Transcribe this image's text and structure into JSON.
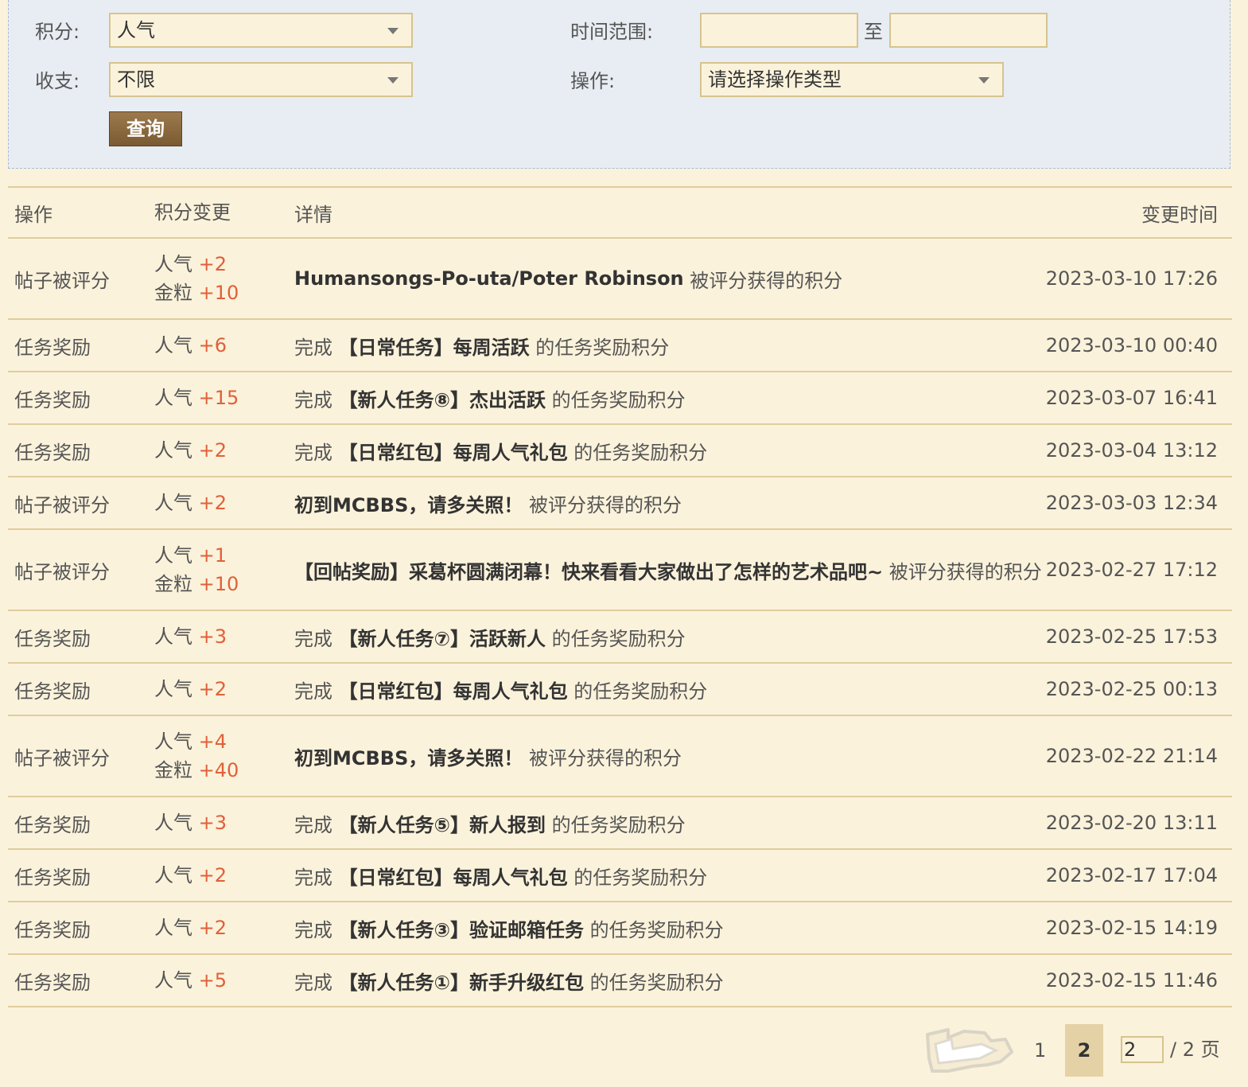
{
  "filter": {
    "score_label": "积分:",
    "score_value": "人气",
    "flow_label": "收支:",
    "flow_value": "不限",
    "time_label": "时间范围:",
    "time_from": "",
    "time_sep": "至",
    "time_to": "",
    "op_label": "操作:",
    "op_value": "请选择操作类型",
    "query_label": "查询"
  },
  "table": {
    "headers": {
      "op": "操作",
      "change": "积分变更",
      "detail": "详情",
      "time": "变更时间"
    },
    "rows": [
      {
        "op": "帖子被评分",
        "changes": [
          {
            "k": "人气",
            "v": "+2"
          },
          {
            "k": "金粒",
            "v": "+10"
          }
        ],
        "prefix": "",
        "bold": "Humansongs-Po-uta/Poter Robinson",
        "suffix": " 被评分获得的积分",
        "time": "2023-03-10 17:26"
      },
      {
        "op": "任务奖励",
        "changes": [
          {
            "k": "人气",
            "v": "+6"
          }
        ],
        "prefix": "完成 ",
        "bold": "【日常任务】每周活跃",
        "suffix": " 的任务奖励积分",
        "time": "2023-03-10 00:40"
      },
      {
        "op": "任务奖励",
        "changes": [
          {
            "k": "人气",
            "v": "+15"
          }
        ],
        "prefix": "完成 ",
        "bold": "【新人任务⑧】杰出活跃",
        "suffix": " 的任务奖励积分",
        "time": "2023-03-07 16:41"
      },
      {
        "op": "任务奖励",
        "changes": [
          {
            "k": "人气",
            "v": "+2"
          }
        ],
        "prefix": "完成 ",
        "bold": "【日常红包】每周人气礼包",
        "suffix": " 的任务奖励积分",
        "time": "2023-03-04 13:12"
      },
      {
        "op": "帖子被评分",
        "changes": [
          {
            "k": "人气",
            "v": "+2"
          }
        ],
        "prefix": "",
        "bold": "初到MCBBS，请多关照！",
        "suffix": " 被评分获得的积分",
        "time": "2023-03-03 12:34"
      },
      {
        "op": "帖子被评分",
        "changes": [
          {
            "k": "人气",
            "v": "+1"
          },
          {
            "k": "金粒",
            "v": "+10"
          }
        ],
        "prefix": "",
        "bold": "【回帖奖励】采葛杯圆满闭幕！快来看看大家做出了怎样的艺术品吧~",
        "suffix": " 被评分获得的积分",
        "time": "2023-02-27 17:12"
      },
      {
        "op": "任务奖励",
        "changes": [
          {
            "k": "人气",
            "v": "+3"
          }
        ],
        "prefix": "完成 ",
        "bold": "【新人任务⑦】活跃新人",
        "suffix": " 的任务奖励积分",
        "time": "2023-02-25 17:53"
      },
      {
        "op": "任务奖励",
        "changes": [
          {
            "k": "人气",
            "v": "+2"
          }
        ],
        "prefix": "完成 ",
        "bold": "【日常红包】每周人气礼包",
        "suffix": " 的任务奖励积分",
        "time": "2023-02-25 00:13"
      },
      {
        "op": "帖子被评分",
        "changes": [
          {
            "k": "人气",
            "v": "+4"
          },
          {
            "k": "金粒",
            "v": "+40"
          }
        ],
        "prefix": "",
        "bold": "初到MCBBS，请多关照！",
        "suffix": " 被评分获得的积分",
        "time": "2023-02-22 21:14"
      },
      {
        "op": "任务奖励",
        "changes": [
          {
            "k": "人气",
            "v": "+3"
          }
        ],
        "prefix": "完成 ",
        "bold": "【新人任务⑤】新人报到",
        "suffix": " 的任务奖励积分",
        "time": "2023-02-20 13:11"
      },
      {
        "op": "任务奖励",
        "changes": [
          {
            "k": "人气",
            "v": "+2"
          }
        ],
        "prefix": "完成 ",
        "bold": "【日常红包】每周人气礼包",
        "suffix": " 的任务奖励积分",
        "time": "2023-02-17 17:04"
      },
      {
        "op": "任务奖励",
        "changes": [
          {
            "k": "人气",
            "v": "+2"
          }
        ],
        "prefix": "完成 ",
        "bold": "【新人任务③】验证邮箱任务",
        "suffix": " 的任务奖励积分",
        "time": "2023-02-15 14:19"
      },
      {
        "op": "任务奖励",
        "changes": [
          {
            "k": "人气",
            "v": "+5"
          }
        ],
        "prefix": "完成 ",
        "bold": "【新人任务①】新手升级红包",
        "suffix": " 的任务奖励积分",
        "time": "2023-02-15 11:46"
      }
    ]
  },
  "pager": {
    "back_icon": "back-arrow-icon",
    "page1": "1",
    "current": "2",
    "input_value": "2",
    "total": "/ 2 页"
  },
  "colors": {
    "background": "#fbf2db",
    "filter_bg": "#e8edf3",
    "positive": "#e0603a",
    "border": "#e0cd9c"
  }
}
